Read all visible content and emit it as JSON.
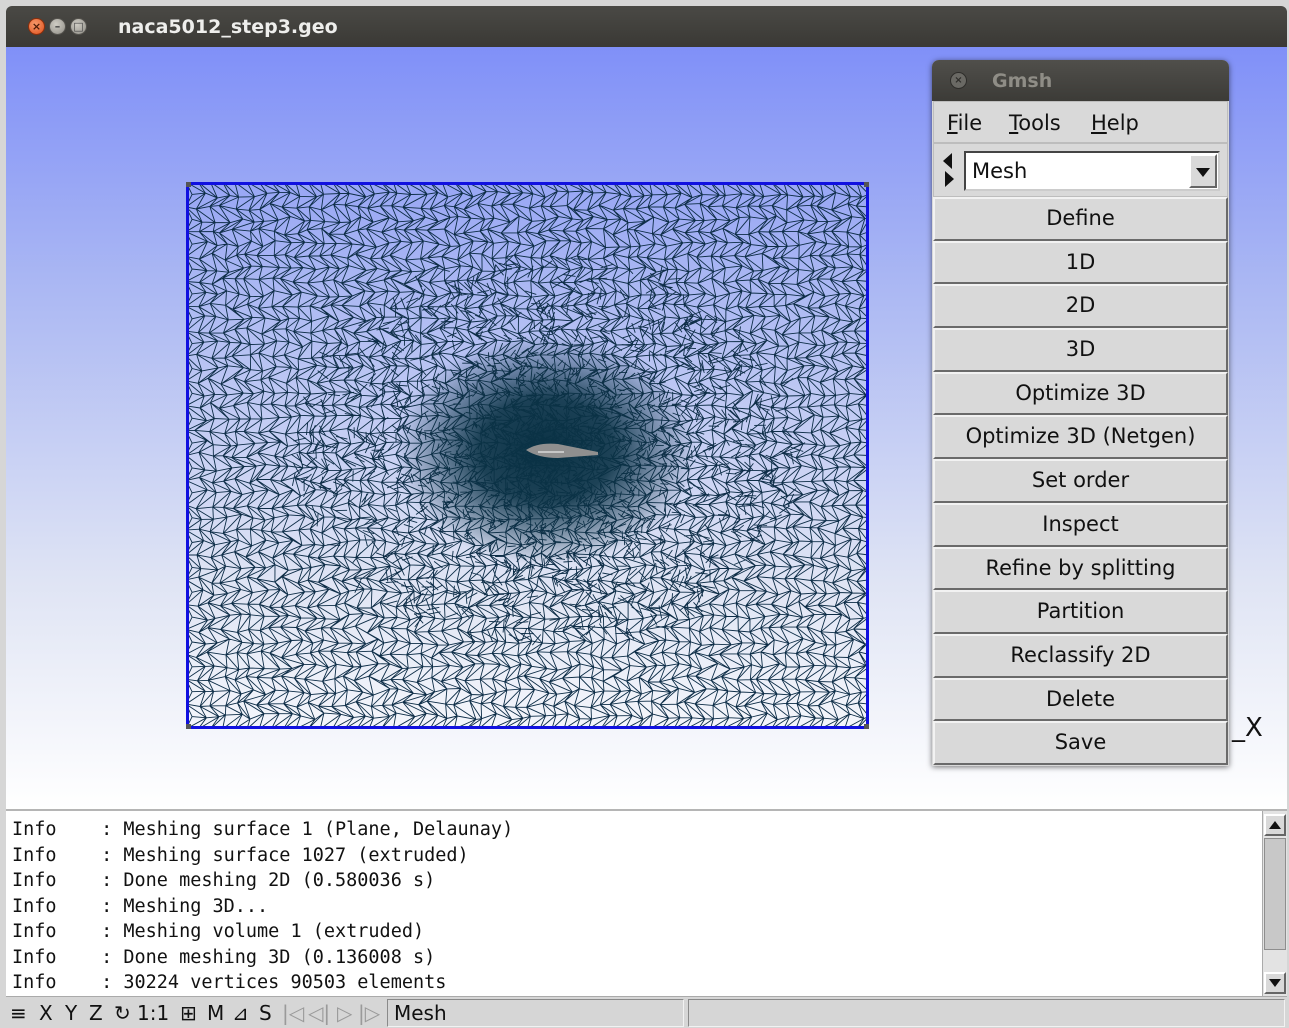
{
  "window": {
    "title": "naca5012_step3.geo",
    "close_glyph": "×",
    "min_glyph": "–",
    "max_glyph": "□"
  },
  "graphics": {
    "axis_label": "_X",
    "colors": {
      "mesh_line": "#0d2d47",
      "boundary": "#1010e0",
      "airfoil": "#8f8f8f",
      "dense_core": "#0a3245"
    }
  },
  "gmsh_panel": {
    "title": "Gmsh",
    "close_glyph": "×",
    "menu": [
      {
        "accel": "F",
        "rest": "ile"
      },
      {
        "accel": "T",
        "rest": "ools"
      },
      {
        "accel": "H",
        "rest": "elp"
      }
    ],
    "module_select": {
      "value": "Mesh"
    },
    "buttons": [
      "Define",
      "1D",
      "2D",
      "3D",
      "Optimize 3D",
      "Optimize 3D (Netgen)",
      "Set order",
      "Inspect",
      "Refine by splitting",
      "Partition",
      "Reclassify 2D",
      "Delete",
      "Save"
    ]
  },
  "console": {
    "lines": [
      "Info    : Meshing surface 1 (Plane, Delaunay)",
      "Info    : Meshing surface 1027 (extruded)",
      "Info    : Done meshing 2D (0.580036 s)",
      "Info    : Meshing 3D...",
      "Info    : Meshing volume 1 (extruded)",
      "Info    : Done meshing 3D (0.136008 s)",
      "Info    : 30224 vertices 90503 elements"
    ]
  },
  "statusbar": {
    "menu_glyph": "≡",
    "x": "X",
    "y": "Y",
    "z": "Z",
    "rotate_glyph": "↻",
    "scale": "1:1",
    "ortho_glyph": "⊞",
    "m": "M",
    "select_glyph": "⊿",
    "s": "S",
    "first_glyph": "|◁",
    "prev_glyph": "◁|",
    "next_glyph": "▷",
    "last_glyph": "|▷",
    "message": "Mesh"
  }
}
